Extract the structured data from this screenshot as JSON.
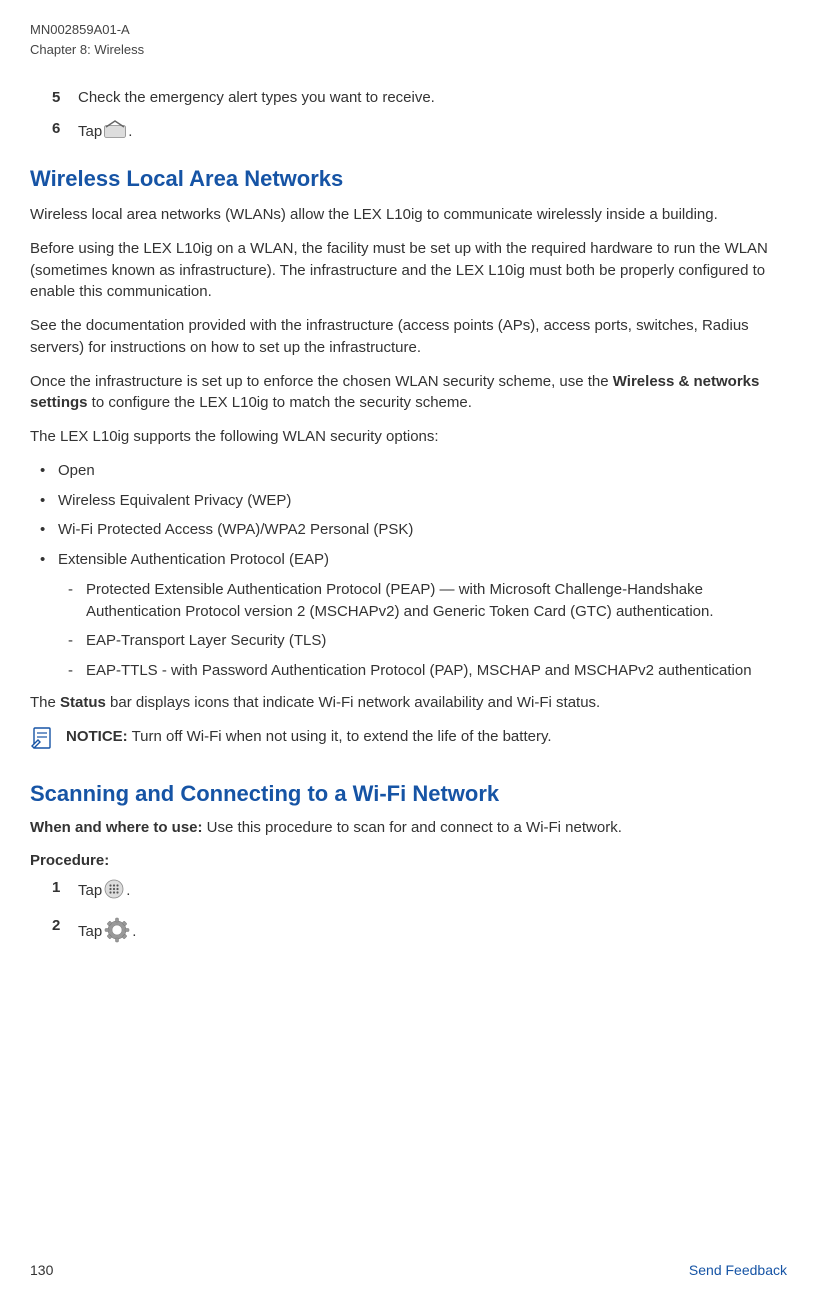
{
  "header": {
    "doc_id": "MN002859A01-A",
    "chapter": "Chapter 8:  Wireless"
  },
  "steps_top": {
    "item5": {
      "num": "5",
      "text": "Check the emergency alert types you want to receive."
    },
    "item6": {
      "num": "6",
      "prefix": "Tap ",
      "suffix": "."
    }
  },
  "wlan": {
    "title": "Wireless Local Area Networks",
    "p1": "Wireless local area networks (WLANs) allow the LEX L10ig to communicate wirelessly inside a building.",
    "p2": "Before using the LEX L10ig on a WLAN, the facility must be set up with the required hardware to run the WLAN (sometimes known as infrastructure). The infrastructure and the LEX L10ig must both be properly configured to enable this communication.",
    "p3": "See the documentation provided with the infrastructure (access points (APs), access ports, switches, Radius servers) for instructions on how to set up the infrastructure.",
    "p4_a": "Once the infrastructure is set up to enforce the chosen WLAN security scheme, use the ",
    "p4_b": "Wireless & networks settings",
    "p4_c": " to configure the LEX L10ig to match the security scheme.",
    "p5": "The LEX L10ig supports the following WLAN security options:",
    "bullets": {
      "b1": "Open",
      "b2": "Wireless Equivalent Privacy (WEP)",
      "b3": "Wi-Fi Protected Access (WPA)/WPA2 Personal (PSK)",
      "b4": "Extensible Authentication Protocol (EAP)",
      "s1": "Protected Extensible Authentication Protocol (PEAP) — with Microsoft Challenge-Handshake Authentication Protocol version 2 (MSCHAPv2) and Generic Token Card (GTC) authentication.",
      "s2": "EAP-Transport Layer Security (TLS)",
      "s3": "EAP-TTLS - with Password Authentication Protocol (PAP), MSCHAP and MSCHAPv2 authentication"
    },
    "p6_a": "The ",
    "p6_b": "Status",
    "p6_c": " bar displays icons that indicate Wi-Fi network availability and Wi-Fi status.",
    "notice_label": "NOTICE:",
    "notice_text": " Turn off Wi-Fi when not using it, to extend the life of the battery."
  },
  "scan": {
    "title": "Scanning and Connecting to a Wi-Fi Network",
    "when_label": "When and where to use:",
    "when_text": " Use this procedure to scan for and connect to a Wi-Fi network.",
    "proc": "Procedure:",
    "item1": {
      "num": "1",
      "prefix": "Tap ",
      "suffix": "."
    },
    "item2": {
      "num": "2",
      "prefix": "Tap ",
      "suffix": "."
    }
  },
  "footer": {
    "page": "130",
    "feedback": "Send Feedback"
  }
}
